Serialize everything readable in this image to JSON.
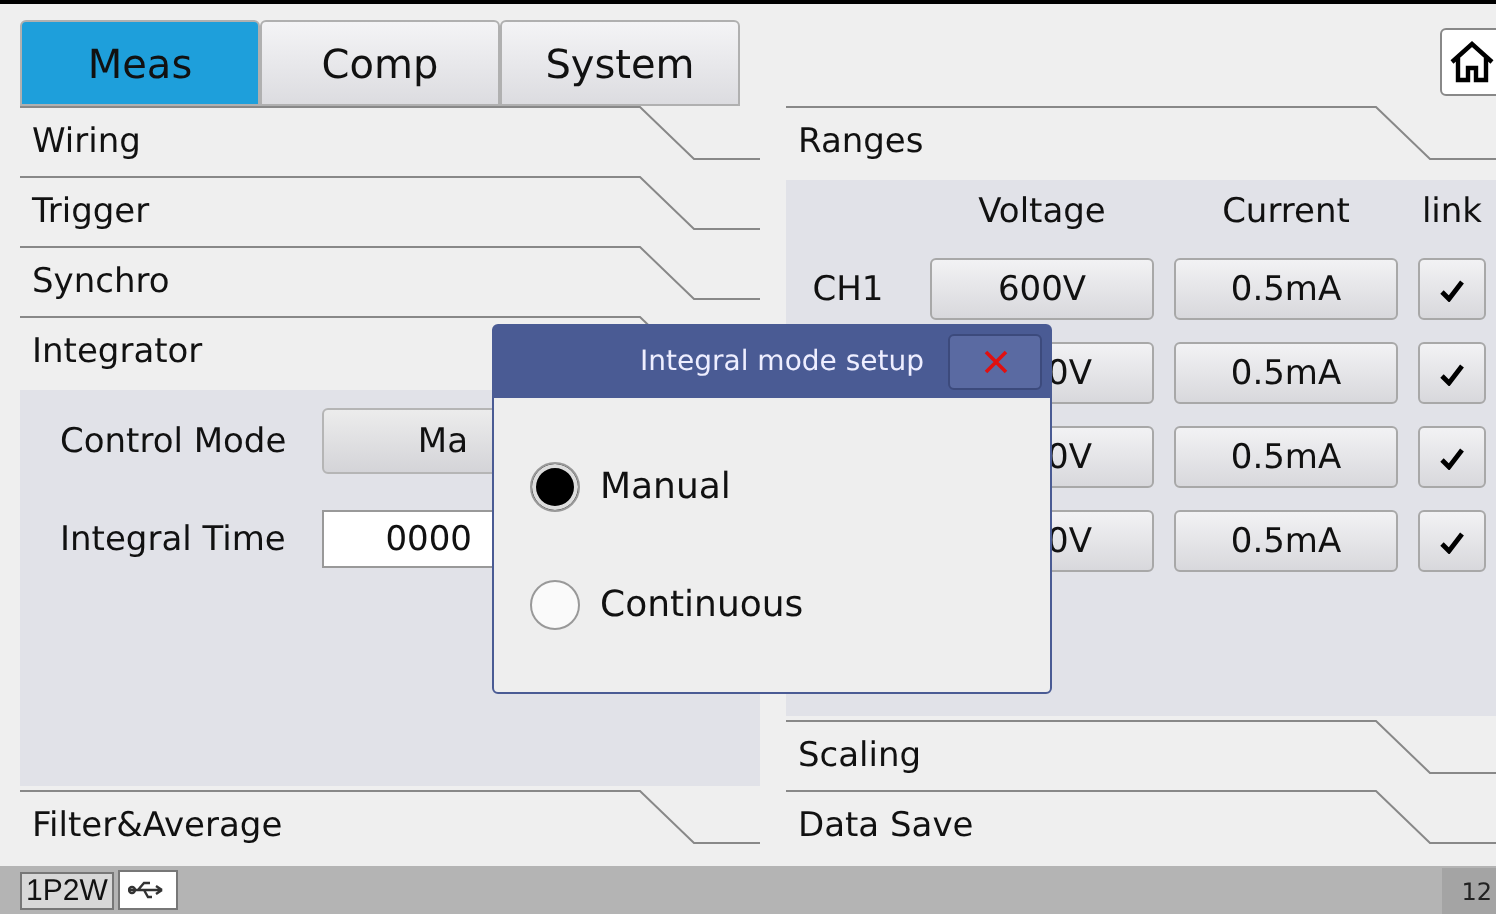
{
  "tabs": [
    {
      "label": "Meas",
      "selected": true
    },
    {
      "label": "Comp",
      "selected": false
    },
    {
      "label": "System",
      "selected": false
    }
  ],
  "left": {
    "sections_top": [
      "Wiring",
      "Trigger",
      "Synchro",
      "Integrator"
    ],
    "integrator_fields": [
      {
        "kind": "select",
        "label": "Control Mode",
        "value": "Ma"
      },
      {
        "kind": "input",
        "label": "Integral Time",
        "value": "0000"
      }
    ],
    "sections_bottom": [
      "Filter&Average"
    ]
  },
  "right": {
    "ranges_title": "Ranges",
    "columns": [
      "Voltage",
      "Current",
      "link"
    ],
    "rows": [
      {
        "label": "CH1",
        "voltage": "600V",
        "current": "0.5mA",
        "link": true
      },
      {
        "voltage": "0V",
        "current": "0.5mA",
        "link": true
      },
      {
        "voltage": "0V",
        "current": "0.5mA",
        "link": true
      },
      {
        "voltage": "0V",
        "current": "0.5mA",
        "link": true
      }
    ],
    "sections": [
      "Scaling",
      "Data Save"
    ]
  },
  "dialog": {
    "title": "Integral mode setup",
    "options": [
      {
        "label": "Manual",
        "selected": true
      },
      {
        "label": "Continuous",
        "selected": false
      }
    ]
  },
  "status_bar": {
    "wiring": "1P2W",
    "page": "12"
  }
}
